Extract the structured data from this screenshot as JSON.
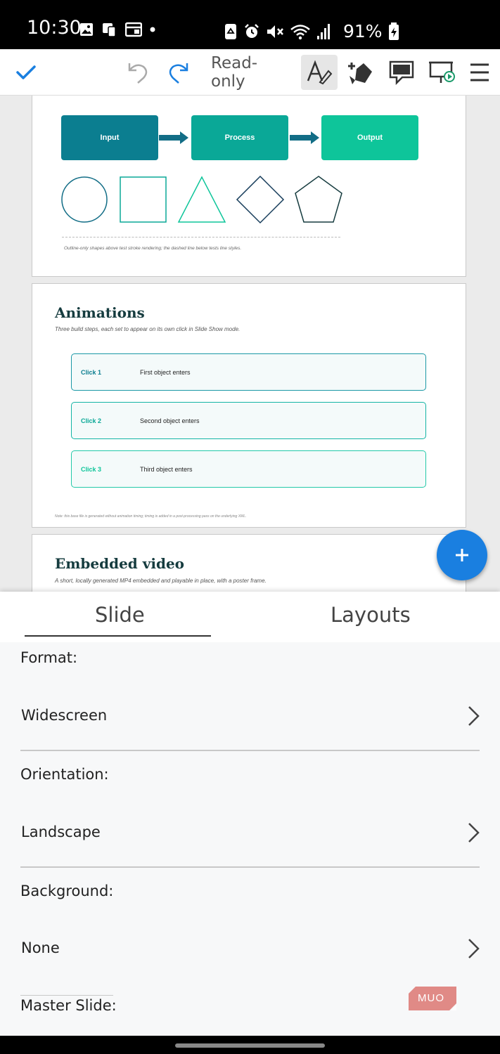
{
  "status_bar": {
    "time": "10:30",
    "battery": "91%",
    "left_icons": [
      "gallery-icon",
      "device-icon",
      "calendar-icon",
      "dot-icon"
    ],
    "right_icons": [
      "recycle-icon",
      "alarm-icon",
      "mute-icon",
      "wifi-icon",
      "signal-icon"
    ]
  },
  "toolbar": {
    "readonly_label": "Read-only",
    "icons": [
      "checkmark-icon",
      "undo-icon",
      "redo-icon",
      "text-edit-icon",
      "insert-shapes-icon",
      "comment-icon",
      "slideshow-icon",
      "menu-icon"
    ]
  },
  "slides": {
    "slide1": {
      "boxes": [
        "Input",
        "Process",
        "Output"
      ],
      "caption": "Outline-only shapes above test stroke rendering; the dashed line below tests line styles."
    },
    "slide2": {
      "title": "Animations",
      "subtitle": "Three build steps, each set to appear on its own click in Slide Show mode.",
      "rows": [
        {
          "label": "Click 1",
          "text": "First object enters"
        },
        {
          "label": "Click 2",
          "text": "Second object enters"
        },
        {
          "label": "Click 3",
          "text": "Third object enters"
        }
      ],
      "note": "Note: this base file is generated without animation timing; timing is added in a post-processing pass on the underlying XML."
    },
    "slide3": {
      "title": "Embedded video",
      "subtitle": "A short, locally generated MP4 embedded and playable in place, with a poster frame."
    }
  },
  "fab_icon": "plus-icon",
  "panel": {
    "tabs": [
      "Slide",
      "Layouts"
    ],
    "active_tab": "Slide",
    "format_label": "Format:",
    "format_value": "Widescreen",
    "orientation_label": "Orientation:",
    "orientation_value": "Landscape",
    "background_label": "Background:",
    "background_value": "None",
    "master_label": "Master Slide:"
  },
  "watermark": "MUO",
  "colors": {
    "accent": "#1a7fe0",
    "teal_dark": "#0b7e90",
    "teal_mid": "#0aa897",
    "teal_light": "#0ec59a"
  }
}
